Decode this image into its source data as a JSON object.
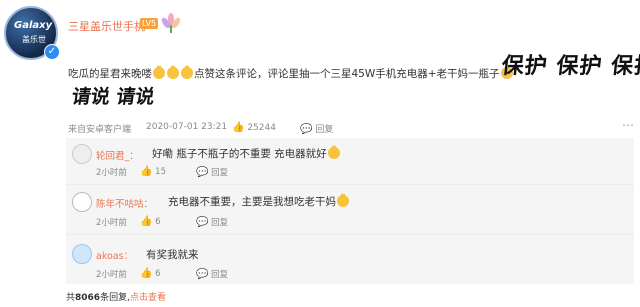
{
  "post": {
    "username": "三星盖乐世手机",
    "level_badge": "LV5",
    "avatar_line1": "Galaxy",
    "avatar_line2": "盖乐世",
    "text_part1": "吃瓜的星君来晚喽",
    "text_part2": "点赞这条评论，评论里抽一个三星45W手机充电器+老干妈一瓶子",
    "big_text_right": "保护 保护 保护",
    "big_text_below": "请说 请说",
    "source": "来自安卓客户端",
    "timestamp": "2020-07-01 23:21",
    "like_count": "25244",
    "reply_label": "回复"
  },
  "replies": [
    {
      "username": "轮回君_",
      "separator": "：",
      "text": "好嘞 瓶子不瓶子的不重要 充电器就好",
      "time": "2小时前",
      "likes": "15",
      "reply_label": "回复"
    },
    {
      "username": "陈年不咕咕",
      "separator": "：",
      "text": "充电器不重要，主要是我想吃老干妈",
      "time": "2小时前",
      "likes": "6",
      "reply_label": "回复"
    },
    {
      "username": "akoas",
      "separator": "：",
      "text": "有奖我就来",
      "time": "2小时前",
      "likes": "6",
      "reply_label": "回复"
    }
  ],
  "footer": {
    "total_prefix": "共",
    "total_count": "8066",
    "total_suffix": "条回复,",
    "view_link": "点击查看"
  },
  "icons": {
    "like": "thumb-up-icon",
    "reply": "reply-icon",
    "more": "more-dots-icon"
  },
  "colors": {
    "username": "#eb7350",
    "text": "#333333",
    "meta": "#8a8a8a",
    "reply_bg": "#f5f5f5"
  }
}
